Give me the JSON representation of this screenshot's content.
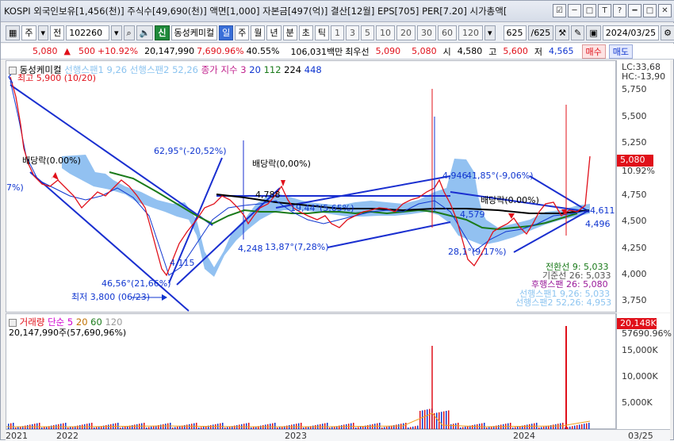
{
  "titlebar": {
    "text": "KOSPI 외국인보유[1,456(천)] 주식수[49,690(천)] 액면[1,000] 자본금[497(억)] 결산[12월] EPS[705] PER[7.20] 시가총액[",
    "buttons": [
      "☑",
      "─",
      "□",
      "T",
      "?",
      "━",
      "□",
      "✕"
    ]
  },
  "toolbar": {
    "market": "주",
    "prev": "전",
    "code": "102260",
    "badge": "신",
    "stock_name": "동성케미컬",
    "periods": [
      "일",
      "주",
      "월",
      "년",
      "분",
      "초",
      "틱"
    ],
    "selected_period": "일",
    "intervals": [
      "1",
      "3",
      "5",
      "10",
      "20",
      "30",
      "60",
      "120"
    ],
    "count": "625",
    "count_total": "/625",
    "date": "2024/03/25"
  },
  "pricebar": {
    "price": "5,080",
    "arrow": "▲",
    "change": "500",
    "change_pct": "+10.92%",
    "volume": "20,147,990",
    "volume_pct": "7,690.96%",
    "turnover": "40.55%",
    "amount": "106,031백만",
    "quote_label": "최우선",
    "ask": "5,090",
    "bid": "5,080",
    "open_label": "시",
    "open": "4,580",
    "high_label": "고",
    "high": "5,600",
    "low_label": "저",
    "low": "4,565",
    "buy": "매수",
    "sell": "매도"
  },
  "main_legend": {
    "name": "동성케미컬",
    "span1": "선행스팬1 9,26",
    "span2": "선행스팬2 52,26",
    "close_index": "종가 지수 3",
    "ma": [
      "20",
      "112",
      "224",
      "448"
    ],
    "ma_colors": [
      "#1036d0",
      "#1a7a1a",
      "#000000",
      "#1036d0"
    ]
  },
  "right_info": {
    "lc": "LC:33,68",
    "hc": "HC:-13,90",
    "price_tag": "5,080",
    "pct_tag": "10.92%"
  },
  "annotations": {
    "high": "최고 5,900 (10/20)",
    "low": "최저 3,800 (06/23)",
    "div1": "배당락(0.00%)",
    "div2": "배당락(0,00%)",
    "div3": "배당락(0.00%)",
    "pct7": "7%)",
    "a1": "62,95°(-20,52%)",
    "a2": "4,788",
    "a3": "4,248",
    "a4": "13,87°(7,28%)",
    "a5": "19,44°(5,65%)",
    "a6": "4,946",
    "a7": "41,85°(-9,06%)",
    "a8": "4,579",
    "a9": "28,1°(9,17%)",
    "a10": "4,611",
    "a11": "4,496",
    "a12": "4,115",
    "a13": "46,56°(21,66%)"
  },
  "ichimoku": {
    "conv": "전환선 9: 5,033",
    "base": "기준선 26: 5,033",
    "lag": "후행스팬 26: 5,080",
    "span1": "선행스팬1 9,26: 5,033",
    "span2": "선행스팬2 52,26: 4,953"
  },
  "price_axis": [
    "5,750",
    "5,500",
    "5,250",
    "5,000",
    "4,750",
    "4,500",
    "4,250",
    "4,000",
    "3,750"
  ],
  "volume_legend": {
    "name": "거래량",
    "simple": "단순",
    "ma": [
      "5",
      "20",
      "60",
      "120"
    ],
    "value": "20,147,990주(57,690,96%)"
  },
  "volume_right": {
    "tag": "20,148K",
    "pct": "57690.96%"
  },
  "volume_axis": [
    "15,000K",
    "10,000K",
    "5,000K"
  ],
  "x_axis": [
    "2021",
    "2022",
    "2023",
    "2024",
    "03/25"
  ],
  "colors": {
    "up": "#e0101a",
    "down": "#1036d0",
    "cloud": "#7fb6ee",
    "trend": "#1a2fd0",
    "ma20": "#1036d0",
    "ma112": "#1a7a1a",
    "ma224": "#000000",
    "ma448": "#1036d0",
    "vol_bar": "#e0101a"
  }
}
